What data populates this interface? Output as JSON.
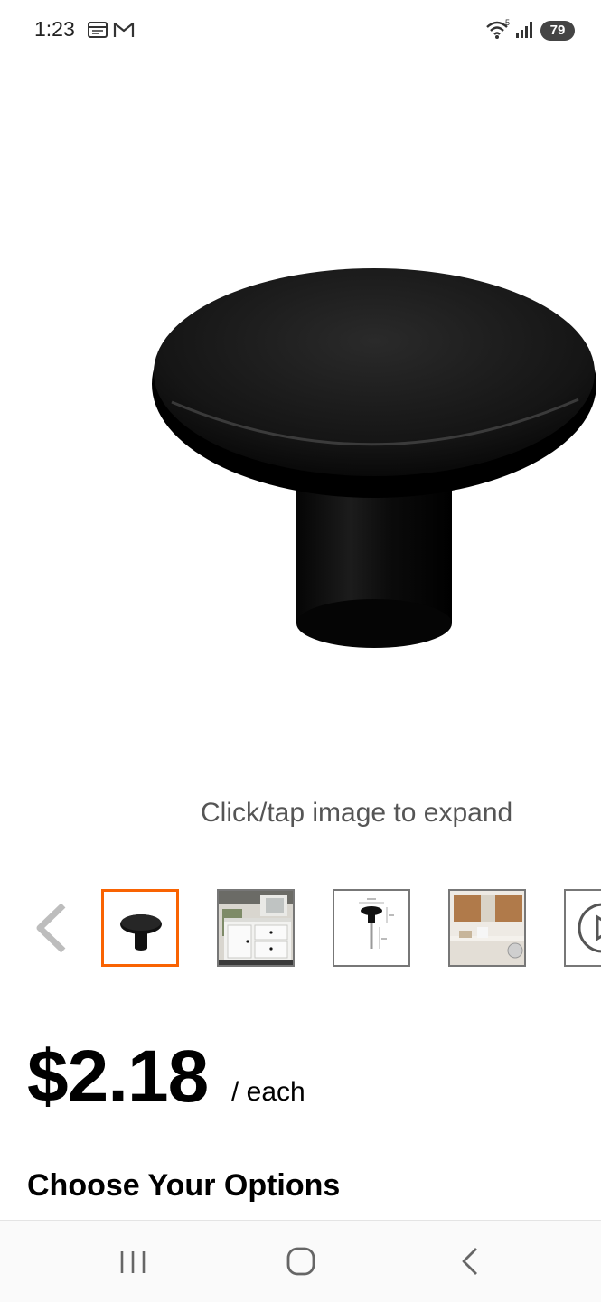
{
  "status_bar": {
    "time": "1:23",
    "battery": "79",
    "icons": [
      "calendar-icon",
      "gmail-icon",
      "wifi-icon",
      "signal-icon",
      "battery-icon"
    ]
  },
  "product": {
    "image_hint": "Click/tap image to expand",
    "thumbnails": [
      {
        "icon": "knob-thumbnail",
        "selected": true
      },
      {
        "icon": "bathroom-vanity-thumbnail",
        "selected": false
      },
      {
        "icon": "dimension-diagram-thumbnail",
        "selected": false
      },
      {
        "icon": "laundry-room-thumbnail",
        "selected": false
      },
      {
        "icon": "video-thumbnail",
        "selected": false
      }
    ],
    "price": "$2.18",
    "price_unit": "/ each"
  },
  "options": {
    "title": "Choose Your Options"
  },
  "nav_bar": {
    "buttons": [
      "recent-apps-icon",
      "home-icon",
      "back-icon"
    ]
  },
  "colors": {
    "accent": "#f96302",
    "text": "#000000",
    "muted": "#555555"
  }
}
